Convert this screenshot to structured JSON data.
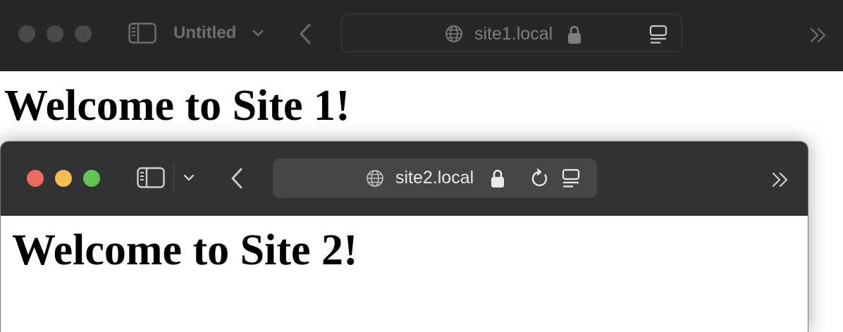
{
  "back_window": {
    "tab_title": "Untitled",
    "url": "site1.local",
    "heading": "Welcome to Site 1!",
    "icons": {
      "sidebar": "sidebar-icon",
      "tab_dropdown": "chevron-down-icon",
      "back": "chevron-left-icon",
      "site": "globe-icon",
      "secure": "lock-icon",
      "reader": "reader-icon",
      "more": "double-chevron-right-icon"
    }
  },
  "front_window": {
    "url": "site2.local",
    "heading": "Welcome to Site 2!",
    "icons": {
      "sidebar": "sidebar-icon",
      "tab_dropdown": "chevron-down-icon",
      "back": "chevron-left-icon",
      "site": "globe-icon",
      "secure": "lock-icon",
      "reload": "reload-icon",
      "reader": "reader-icon",
      "more": "double-chevron-right-icon"
    }
  },
  "colors": {
    "titlebar_inactive": "#272726",
    "titlebar_active": "#323232",
    "close": "#ed6a5e",
    "minimize": "#f5bf4f",
    "maximize": "#61c554"
  }
}
